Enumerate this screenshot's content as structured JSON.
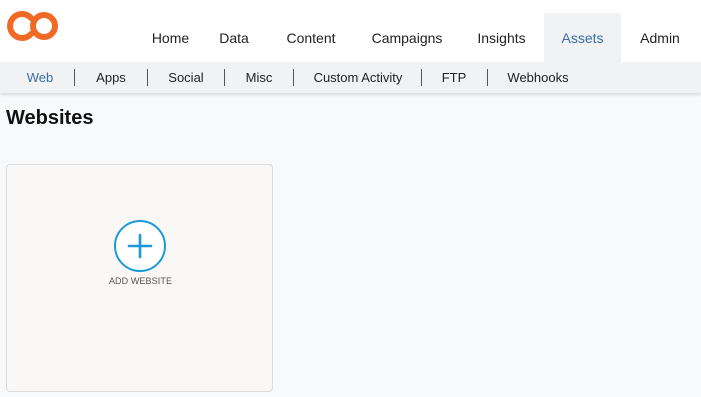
{
  "nav": {
    "items": [
      {
        "label": "Home"
      },
      {
        "label": "Data"
      },
      {
        "label": "Content"
      },
      {
        "label": "Campaigns"
      },
      {
        "label": "Insights"
      },
      {
        "label": "Assets",
        "active": true
      },
      {
        "label": "Admin"
      }
    ]
  },
  "subnav": {
    "items": [
      {
        "label": "Web",
        "active": true
      },
      {
        "label": "Apps"
      },
      {
        "label": "Social"
      },
      {
        "label": "Misc"
      },
      {
        "label": "Custom Activity"
      },
      {
        "label": "FTP"
      },
      {
        "label": "Webhooks"
      }
    ]
  },
  "page": {
    "title": "Websites",
    "add_card": {
      "label": "ADD WEBSITE",
      "icon": "plus-circle-icon"
    }
  },
  "colors": {
    "brand": "#f06a25",
    "accent": "#1a9ad6",
    "active_link": "#3a6ea5"
  }
}
